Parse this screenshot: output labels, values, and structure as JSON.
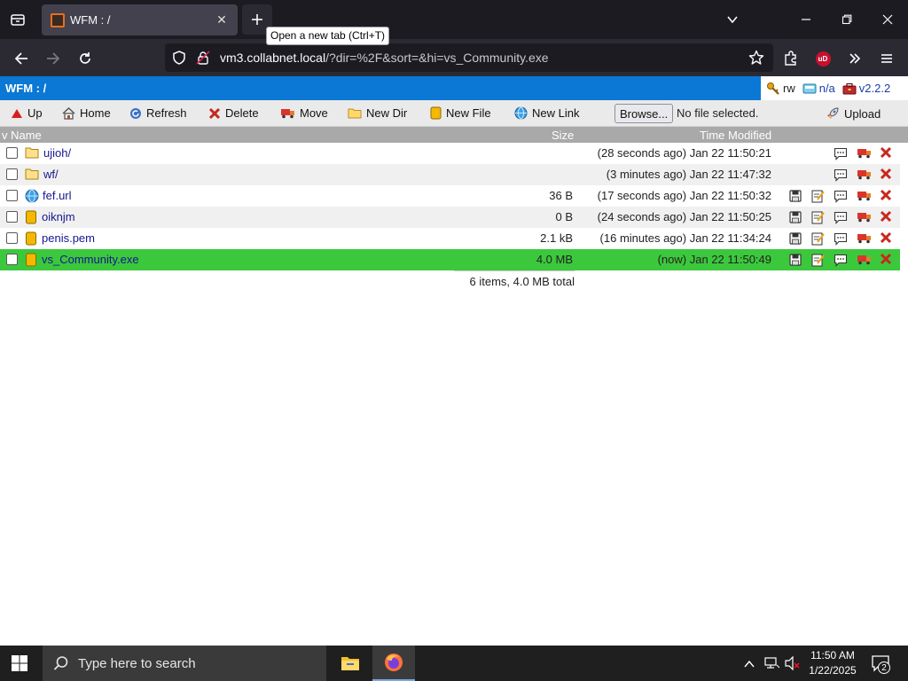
{
  "browser": {
    "tab_title": "WFM : /",
    "newtab_tooltip": "Open a new tab (Ctrl+T)",
    "url_host": "vm3.collabnet.local",
    "url_rest": "/?dir=%2F&sort=&hi=vs_Community.exe",
    "extension_badge": "uD"
  },
  "app": {
    "title": "WFM : /",
    "perm": "rw",
    "quota": "n/a",
    "version": "v2.2.2",
    "toolbar": {
      "up": "Up",
      "home": "Home",
      "refresh": "Refresh",
      "delete": "Delete",
      "move": "Move",
      "new_dir": "New Dir",
      "new_file": "New File",
      "new_link": "New Link",
      "browse": "Browse...",
      "no_file": "No file selected.",
      "upload": "Upload"
    },
    "columns": {
      "name": "v Name",
      "size": "Size",
      "time": "Time Modified"
    },
    "files": [
      {
        "name": "ujioh/",
        "type": "dir",
        "size": "",
        "time": "(28 seconds ago) Jan 22 11:50:21"
      },
      {
        "name": "wf/",
        "type": "dir",
        "size": "",
        "time": "(3 minutes ago) Jan 22 11:47:32"
      },
      {
        "name": "fef.url",
        "type": "link",
        "size": "36 B",
        "time": "(17 seconds ago) Jan 22 11:50:32"
      },
      {
        "name": "oiknjm",
        "type": "file",
        "size": "0 B",
        "time": "(24 seconds ago) Jan 22 11:50:25"
      },
      {
        "name": "penis.pem",
        "type": "file",
        "size": "2.1 kB",
        "time": "(16 minutes ago) Jan 22 11:34:24"
      },
      {
        "name": "vs_Community.exe",
        "type": "file",
        "size": "4.0 MB",
        "time": "(now) Jan 22 11:50:49",
        "highlighted": true
      }
    ],
    "summary": "6 items, 4.0 MB total"
  },
  "taskbar": {
    "search_placeholder": "Type here to search",
    "time": "11:50 AM",
    "date": "1/22/2025",
    "notifications": "2"
  },
  "colors": {
    "header_blue": "#0a78d4",
    "highlight_green": "#3cc83c",
    "link_blue": "#16168f"
  }
}
